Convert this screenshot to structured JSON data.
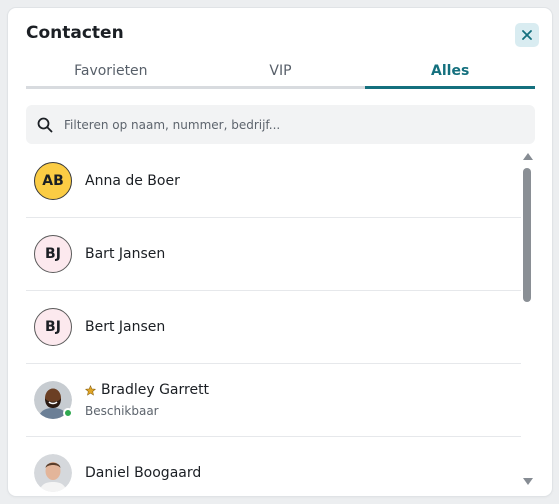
{
  "header": {
    "title": "Contacten",
    "close_icon": "close-icon"
  },
  "tabs": [
    {
      "label": "Favorieten",
      "active": false
    },
    {
      "label": "VIP",
      "active": false
    },
    {
      "label": "Alles",
      "active": true
    }
  ],
  "search": {
    "placeholder": "Filteren op naam, nummer, bedrijf...",
    "value": "",
    "icon": "search-icon"
  },
  "contacts": [
    {
      "initials": "AB",
      "name": "Anna de Boer",
      "avatar_color": "#fbcc44"
    },
    {
      "initials": "BJ",
      "name": "Bart Jansen",
      "avatar_color": "#fce9ee"
    },
    {
      "initials": "BJ",
      "name": "Bert Jansen",
      "avatar_color": "#fce9ee"
    },
    {
      "name": "Bradley Garrett",
      "status": "Beschikbaar",
      "favorite": true,
      "presence": "available",
      "presence_color": "#2fa84f"
    },
    {
      "name": "Daniel Boogaard"
    }
  ],
  "colors": {
    "accent": "#14707e",
    "favorite_star": "#e0a526"
  }
}
